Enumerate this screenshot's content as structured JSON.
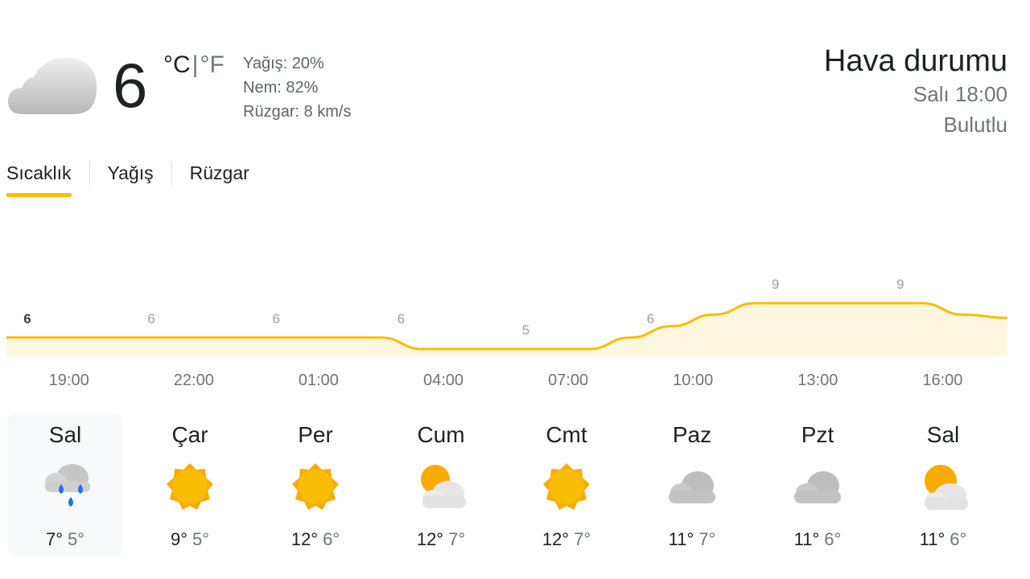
{
  "current": {
    "temp": "6",
    "unit_c": "°C",
    "unit_sep": "|",
    "unit_f": "°F",
    "precip": "Yağış: 20%",
    "humidity": "Nem: 82%",
    "wind": "Rüzgar: 8 km/s",
    "icon": "cloud-icon"
  },
  "header": {
    "title": "Hava durumu",
    "time": "Salı 18:00",
    "condition": "Bulutlu"
  },
  "tabs": [
    {
      "label": "Sıcaklık",
      "active": true
    },
    {
      "label": "Yağış",
      "active": false
    },
    {
      "label": "Rüzgar",
      "active": false
    }
  ],
  "chart_data": {
    "type": "area",
    "x": [
      "18:00",
      "19:00",
      "20:00",
      "21:00",
      "22:00",
      "23:00",
      "00:00",
      "01:00",
      "02:00",
      "03:00",
      "04:00",
      "05:00",
      "06:00",
      "07:00",
      "08:00",
      "09:00",
      "10:00",
      "11:00",
      "12:00",
      "13:00",
      "14:00",
      "15:00",
      "16:00",
      "17:00"
    ],
    "y": [
      6,
      6,
      6,
      6,
      6,
      6,
      6,
      6,
      6,
      6,
      5,
      5,
      5,
      5,
      5,
      6,
      7,
      8,
      9,
      9,
      9,
      9,
      9,
      8
    ],
    "point_labels": [
      {
        "index": 0,
        "text": "6"
      },
      {
        "index": 3,
        "text": "6"
      },
      {
        "index": 6,
        "text": "6"
      },
      {
        "index": 9,
        "text": "6"
      },
      {
        "index": 12,
        "text": "5"
      },
      {
        "index": 15,
        "text": "6"
      },
      {
        "index": 18,
        "text": "9"
      },
      {
        "index": 21,
        "text": "9"
      }
    ],
    "tick_labels": [
      "19:00",
      "22:00",
      "01:00",
      "04:00",
      "07:00",
      "10:00",
      "13:00",
      "16:00"
    ],
    "tick_index": [
      1,
      4,
      7,
      10,
      13,
      16,
      19,
      22
    ],
    "line_color": "#fbbc04",
    "fill_color": "#fef7e0"
  },
  "days": [
    {
      "name": "Sal",
      "icon": "rain-cloud-icon",
      "high": "7°",
      "low": "5°",
      "selected": true
    },
    {
      "name": "Çar",
      "icon": "sun-icon",
      "high": "9°",
      "low": "5°",
      "selected": false
    },
    {
      "name": "Per",
      "icon": "sun-icon",
      "high": "12°",
      "low": "6°",
      "selected": false
    },
    {
      "name": "Cum",
      "icon": "partly-cloudy-icon",
      "high": "12°",
      "low": "7°",
      "selected": false
    },
    {
      "name": "Cmt",
      "icon": "sun-icon",
      "high": "12°",
      "low": "7°",
      "selected": false
    },
    {
      "name": "Paz",
      "icon": "cloud-icon",
      "high": "11°",
      "low": "7°",
      "selected": false
    },
    {
      "name": "Pzt",
      "icon": "cloud-icon",
      "high": "11°",
      "low": "6°",
      "selected": false
    },
    {
      "name": "Sal",
      "icon": "partly-cloudy-icon",
      "high": "11°",
      "low": "6°",
      "selected": false
    }
  ]
}
